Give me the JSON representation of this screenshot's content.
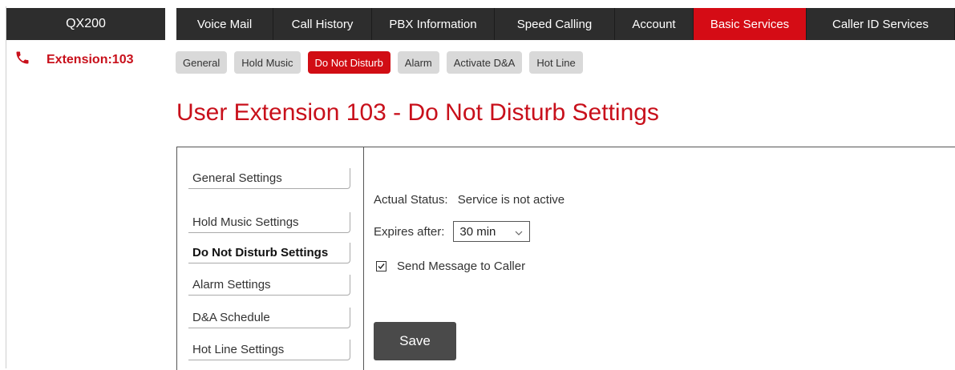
{
  "brand": {
    "title": "QX200"
  },
  "topnav": {
    "tabs": [
      {
        "label": "Voice Mail",
        "active": false
      },
      {
        "label": "Call History",
        "active": false
      },
      {
        "label": "PBX Information",
        "active": false
      },
      {
        "label": "Speed Calling",
        "active": false
      },
      {
        "label": "Account",
        "active": false
      },
      {
        "label": "Basic Services",
        "active": true
      },
      {
        "label": "Caller ID Services",
        "active": false
      }
    ]
  },
  "extension": {
    "label": "Extension:103",
    "icon": "phone-icon"
  },
  "subtabs": [
    {
      "label": "General",
      "active": false
    },
    {
      "label": "Hold Music",
      "active": false
    },
    {
      "label": "Do Not Disturb",
      "active": true
    },
    {
      "label": "Alarm",
      "active": false
    },
    {
      "label": "Activate D&A",
      "active": false
    },
    {
      "label": "Hot Line",
      "active": false
    }
  ],
  "page": {
    "title": "User Extension 103 - Do Not Disturb Settings"
  },
  "side_menu": [
    {
      "label": "General Settings",
      "active": false
    },
    {
      "label": "Hold Music Settings",
      "active": false
    },
    {
      "label": "Do Not Disturb Settings",
      "active": true
    },
    {
      "label": "Alarm Settings",
      "active": false
    },
    {
      "label": "D&A Schedule",
      "active": false
    },
    {
      "label": "Hot Line Settings",
      "active": false
    }
  ],
  "settings": {
    "status_label": "Actual Status:",
    "status_value": "Service is not active",
    "expires_label": "Expires after:",
    "expires_value": "30 min",
    "send_message_label": "Send Message to Caller",
    "send_message_checked": true,
    "save_label": "Save"
  },
  "colors": {
    "accent": "#d50c15",
    "nav_bg": "#2d2d2d",
    "subtab_bg": "#d9d9d9",
    "save_bg": "#4a4a4a"
  }
}
